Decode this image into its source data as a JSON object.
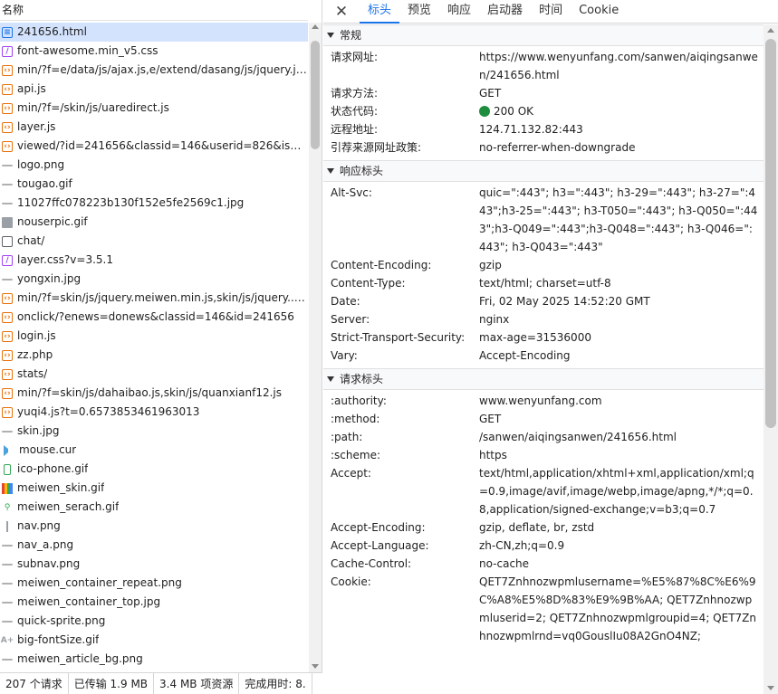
{
  "list": {
    "header": "名称",
    "rows": [
      {
        "name": "241656.html",
        "icon": "document-icon"
      },
      {
        "name": "font-awesome.min_v5.css",
        "icon": "stylesheet-icon"
      },
      {
        "name": "min/?f=e/data/js/ajax.js,e/extend/dasang/js/jquery.js,...",
        "icon": "script-icon"
      },
      {
        "name": "api.js",
        "icon": "script-icon"
      },
      {
        "name": "min/?f=/skin/js/uaredirect.js",
        "icon": "script-icon"
      },
      {
        "name": "layer.js",
        "icon": "script-icon"
      },
      {
        "name": "viewed/?id=241656&classid=146&userid=826&isme...",
        "icon": "script-icon"
      },
      {
        "name": "logo.png",
        "icon": "image-icon"
      },
      {
        "name": "tougao.gif",
        "icon": "image-icon"
      },
      {
        "name": "11027ffc078223b130f152e5fe2569c1.jpg",
        "icon": "image-icon"
      },
      {
        "name": "nouserpic.gif",
        "icon": "avatar-image-icon"
      },
      {
        "name": "chat/",
        "icon": "page-icon"
      },
      {
        "name": "layer.css?v=3.5.1",
        "icon": "stylesheet-icon"
      },
      {
        "name": "yongxin.jpg",
        "icon": "image-icon"
      },
      {
        "name": "min/?f=skin/js/jquery.meiwen.min.js,skin/js/jquery...d...",
        "icon": "script-icon"
      },
      {
        "name": "onclick/?enews=donews&classid=146&id=241656",
        "icon": "script-icon"
      },
      {
        "name": "login.js",
        "icon": "script-icon"
      },
      {
        "name": "zz.php",
        "icon": "script-icon"
      },
      {
        "name": "stats/",
        "icon": "script-icon"
      },
      {
        "name": "min/?f=skin/js/dahaibao.js,skin/js/quanxianf12.js",
        "icon": "script-icon"
      },
      {
        "name": "yuqi4.js?t=0.6573853461963013",
        "icon": "script-icon"
      },
      {
        "name": "skin.jpg",
        "icon": "image-icon"
      },
      {
        "name": "mouse.cur",
        "icon": "cursor-icon"
      },
      {
        "name": "ico-phone.gif",
        "icon": "phone-icon"
      },
      {
        "name": "meiwen_skin.gif",
        "icon": "grid-image-icon"
      },
      {
        "name": "meiwen_serach.gif",
        "icon": "magnifier-image-icon"
      },
      {
        "name": "nav.png",
        "icon": "bar-image-icon"
      },
      {
        "name": "nav_a.png",
        "icon": "image-icon"
      },
      {
        "name": "subnav.png",
        "icon": "image-icon"
      },
      {
        "name": "meiwen_container_repeat.png",
        "icon": "image-icon"
      },
      {
        "name": "meiwen_container_top.jpg",
        "icon": "image-icon"
      },
      {
        "name": "quick-sprite.png",
        "icon": "image-icon"
      },
      {
        "name": "big-fontSize.gif",
        "icon": "font-image-icon"
      },
      {
        "name": "meiwen_article_bg.png",
        "icon": "image-icon"
      }
    ]
  },
  "status": {
    "requests": "207 个请求",
    "transferred": "已传输 1.9 MB",
    "resources": "3.4 MB 项资源",
    "finish": "完成用时: 8."
  },
  "tabs": [
    "标头",
    "预览",
    "响应",
    "启动器",
    "时间",
    "Cookie"
  ],
  "sections": {
    "general": {
      "title": "常规",
      "items": [
        {
          "k": "请求网址:",
          "v": "https://www.wenyunfang.com/sanwen/aiqingsanwen/241656.html"
        },
        {
          "k": "请求方法:",
          "v": "GET"
        },
        {
          "k": "状态代码:",
          "v": "200 OK"
        },
        {
          "k": "远程地址:",
          "v": "124.71.132.82:443"
        },
        {
          "k": "引荐来源网址政策:",
          "v": "no-referrer-when-downgrade"
        }
      ]
    },
    "response": {
      "title": "响应标头",
      "items": [
        {
          "k": "Alt-Svc:",
          "v": "quic=\":443\"; h3=\":443\"; h3-29=\":443\"; h3-27=\":443\";h3-25=\":443\"; h3-T050=\":443\"; h3-Q050=\":443\";h3-Q049=\":443\";h3-Q048=\":443\"; h3-Q046=\":443\"; h3-Q043=\":443\""
        },
        {
          "k": "Content-Encoding:",
          "v": "gzip"
        },
        {
          "k": "Content-Type:",
          "v": "text/html; charset=utf-8"
        },
        {
          "k": "Date:",
          "v": "Fri, 02 May 2025 14:52:20 GMT"
        },
        {
          "k": "Server:",
          "v": "nginx"
        },
        {
          "k": "Strict-Transport-Security:",
          "v": "max-age=31536000"
        },
        {
          "k": "Vary:",
          "v": "Accept-Encoding"
        }
      ]
    },
    "request": {
      "title": "请求标头",
      "items": [
        {
          "k": ":authority:",
          "v": "www.wenyunfang.com"
        },
        {
          "k": ":method:",
          "v": "GET"
        },
        {
          "k": ":path:",
          "v": "/sanwen/aiqingsanwen/241656.html"
        },
        {
          "k": ":scheme:",
          "v": "https"
        },
        {
          "k": "Accept:",
          "v": "text/html,application/xhtml+xml,application/xml;q=0.9,image/avif,image/webp,image/apng,*/*;q=0.8,application/signed-exchange;v=b3;q=0.7"
        },
        {
          "k": "Accept-Encoding:",
          "v": "gzip, deflate, br, zstd"
        },
        {
          "k": "Accept-Language:",
          "v": "zh-CN,zh;q=0.9"
        },
        {
          "k": "Cache-Control:",
          "v": "no-cache"
        },
        {
          "k": "Cookie:",
          "v": "QET7Znhnozwpmlusername=%E5%87%8C%E6%9C%A8%E5%8D%83%E9%9B%AA; QET7Znhnozwpmluserid=2; QET7Znhnozwpmlgroupid=4; QET7Znhnozwpmlrnd=vq0GouslIu08A2GnO4NZ;"
        }
      ]
    }
  },
  "colors": {
    "accent": "#1a73e8",
    "selected_row": "#d3e3fd",
    "status_ok": "#1e8e3e"
  }
}
